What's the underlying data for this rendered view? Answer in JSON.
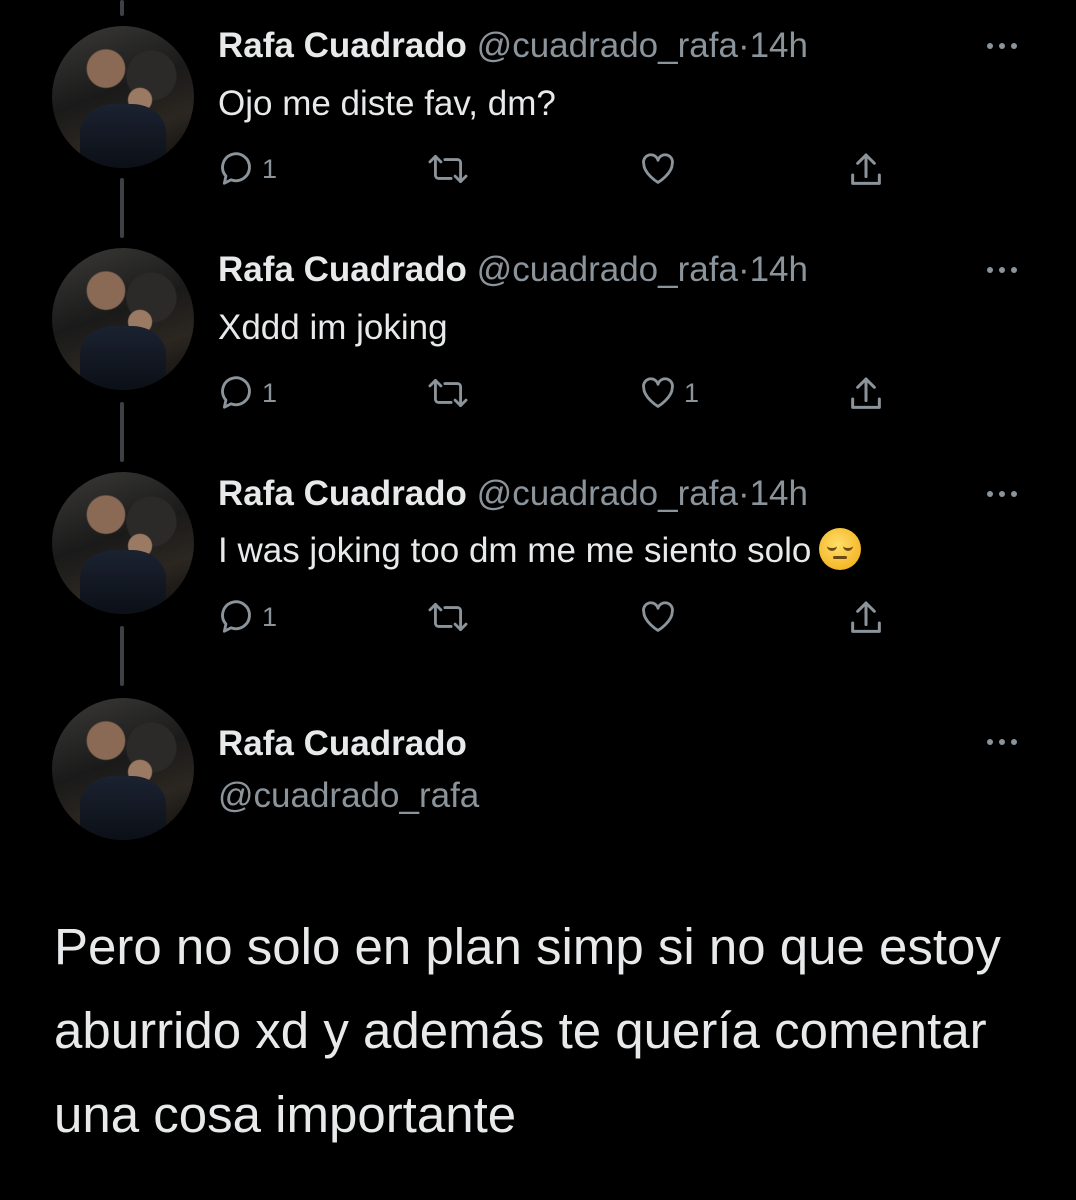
{
  "author": {
    "name": "Rafa Cuadrado",
    "handle": "@cuadrado_rafa"
  },
  "tweets": [
    {
      "time": "14h",
      "text": "Ojo me diste fav, dm?",
      "replies": "1",
      "retweets": "",
      "likes": ""
    },
    {
      "time": "14h",
      "text": "Xddd im joking",
      "replies": "1",
      "retweets": "",
      "likes": "1"
    },
    {
      "time": "14h",
      "text": "I was joking too dm me me siento solo",
      "emoji": "pensive-face",
      "replies": "1",
      "retweets": "",
      "likes": ""
    }
  ],
  "main_tweet": {
    "name": "Rafa Cuadrado",
    "handle": "@cuadrado_rafa",
    "text": "Pero no solo en plan simp si no que estoy aburrido xd y además te quería comentar una cosa importante"
  },
  "separator": "·",
  "colors": {
    "background": "#000000",
    "text": "#e7e9ea",
    "secondary": "#8b949b",
    "thread_line": "#3d4146"
  },
  "icons": [
    "reply-icon",
    "retweet-icon",
    "like-icon",
    "share-icon",
    "more-icon"
  ]
}
